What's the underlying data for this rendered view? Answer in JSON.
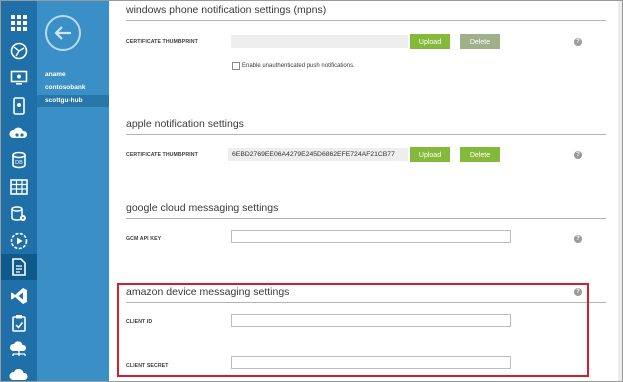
{
  "nav": {
    "items": [
      {
        "label": "aname",
        "active": false
      },
      {
        "label": "contosobank",
        "active": false
      },
      {
        "label": "scottgu-hub",
        "active": true
      }
    ]
  },
  "rail": {
    "icons": [
      "grid-icon",
      "globe-icon",
      "monitor-icon",
      "mobile-icon",
      "cloud-gears-icon",
      "database-icon",
      "table-icon",
      "database-gear-icon",
      "play-icon",
      "document-icon",
      "visual-studio-icon",
      "clipboard-icon",
      "network-cloud-icon",
      "cloud-icon"
    ]
  },
  "colors": {
    "accent": "#1f70a8",
    "nav": "#3a8fc7",
    "button": "#84b93c",
    "highlight": "#cf2030"
  },
  "sections": {
    "windows_phone": {
      "title": "windows phone notification settings (mpns)",
      "certificate_label": "CERTIFICATE THUMBPRINT",
      "certificate_value": "",
      "upload_label": "Upload",
      "delete_label": "Delete",
      "checkbox_label": "Enable unauthenticated push notifications.",
      "checkbox_checked": false,
      "help_label": "?"
    },
    "apple": {
      "title": "apple notification settings",
      "certificate_label": "CERTIFICATE THUMBPRINT",
      "certificate_value": "6EBD2769EE06A4279E245D6862EFE724AF21CB77",
      "upload_label": "Upload",
      "delete_label": "Delete",
      "help_label": "?"
    },
    "google": {
      "title": "google cloud messaging settings",
      "api_key_label": "GCM API KEY",
      "api_key_value": "",
      "help_label": "?"
    },
    "amazon": {
      "title": "amazon device messaging settings",
      "client_id_label": "CLIENT ID",
      "client_id_value": "",
      "client_secret_label": "CLIENT SECRET",
      "client_secret_value": "",
      "help_label": "?"
    }
  }
}
